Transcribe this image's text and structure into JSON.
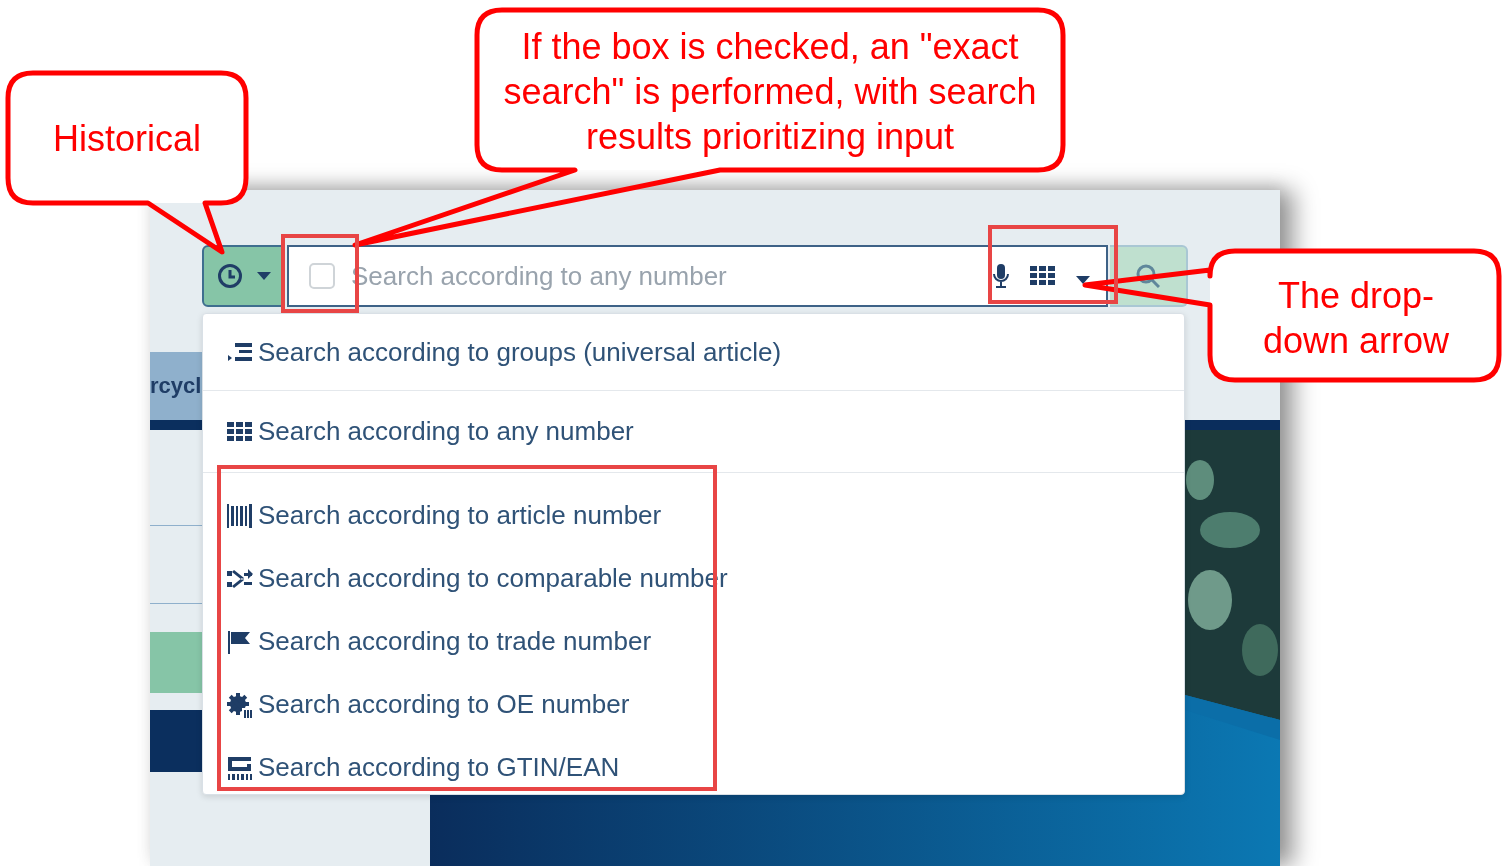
{
  "annotations": {
    "callouts": [
      {
        "text": "Historical"
      },
      {
        "text": "If the box is checked, an \"exact search\" is performed, with search results prioritizing input"
      },
      {
        "text": "The drop-down arrow"
      }
    ]
  },
  "sidebar": {
    "text": "rcycl"
  },
  "search_bar": {
    "exact_checkbox": {
      "checked": false
    },
    "placeholder": "Search according to any number"
  },
  "dropdown": {
    "items": [
      {
        "label": "Search according to groups (universal article)",
        "kind": "groups"
      },
      {
        "label": "Search according to any number",
        "kind": "grid"
      },
      {
        "label": "Search according to article number",
        "kind": "barcode"
      },
      {
        "label": "Search according to comparable number",
        "kind": "shuffle"
      },
      {
        "label": "Search according to trade number",
        "kind": "flag"
      },
      {
        "label": "Search according to OE number",
        "kind": "gear"
      },
      {
        "label": "Search according to GTIN/EAN",
        "kind": "gtin"
      }
    ]
  }
}
